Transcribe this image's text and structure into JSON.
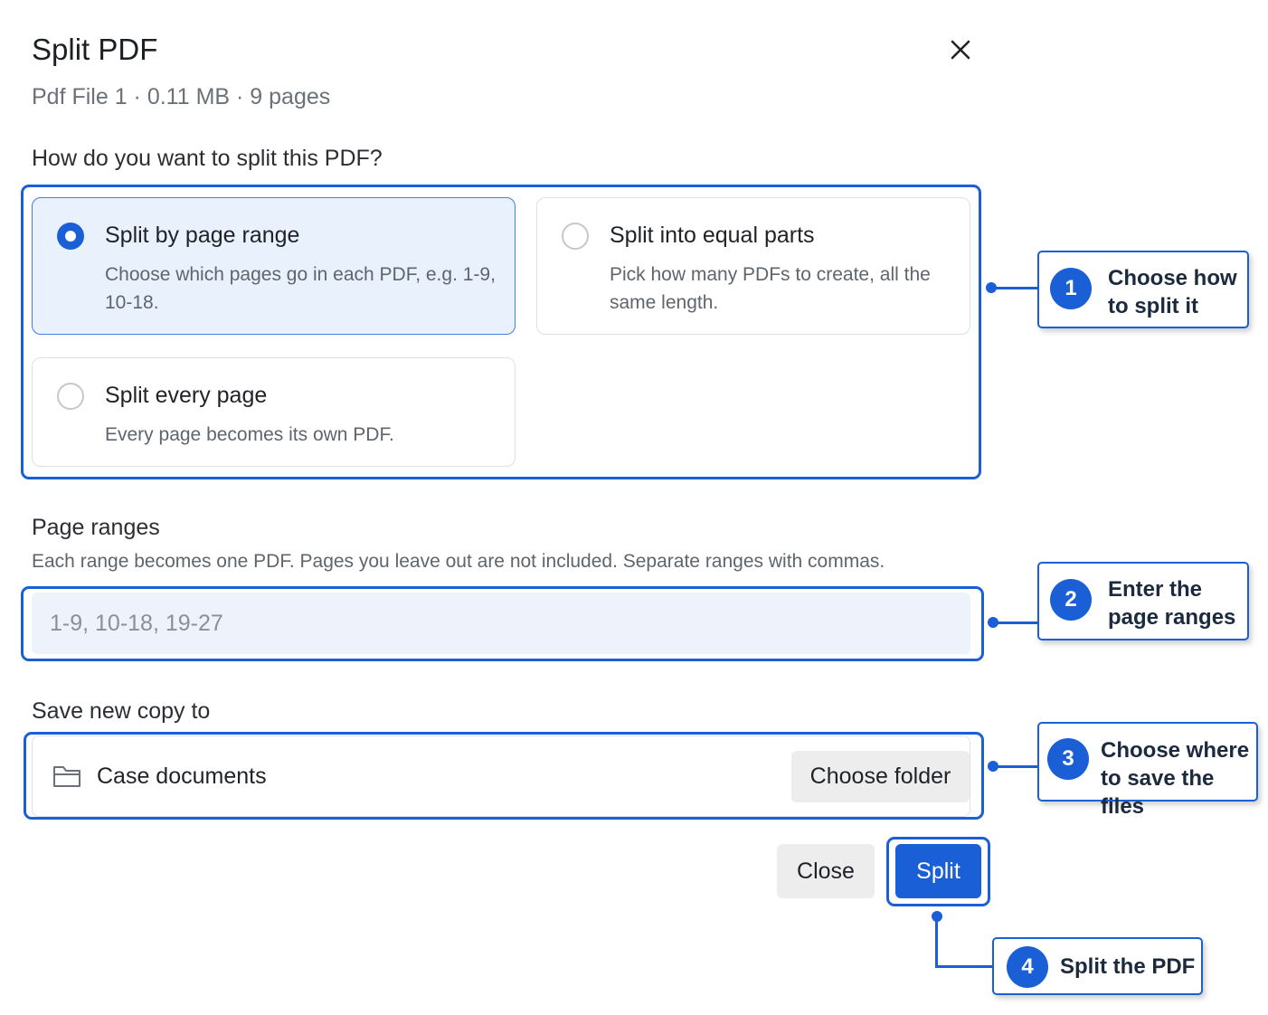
{
  "dialog": {
    "title": "Split PDF",
    "subtitle": "Pdf File 1 · 0.11 MB · 9 pages"
  },
  "split_mode": {
    "question": "How do you want to split this PDF?",
    "options": [
      {
        "title": "Split by page range",
        "description": "Choose which pages go in each PDF, e.g. 1-9, 10-18.",
        "selected": true
      },
      {
        "title": "Split into equal parts",
        "description": "Pick how many PDFs to create, all the same length.",
        "selected": false
      },
      {
        "title": "Split every page",
        "description": "Every page becomes its own PDF.",
        "selected": false
      }
    ]
  },
  "page_ranges": {
    "label": "Page ranges",
    "help": "Each range becomes one PDF. Pages you leave out are not included. Separate ranges with commas.",
    "value": "",
    "placeholder": "1-9, 10-18, 19-27"
  },
  "save_location": {
    "label": "Save new copy to",
    "folder_name": "Case documents",
    "choose_folder_label": "Choose folder"
  },
  "actions": {
    "close_label": "Close",
    "split_label": "Split"
  },
  "callouts": [
    {
      "number": "1",
      "text_line1": "Choose how",
      "text_line2": "to split it"
    },
    {
      "number": "2",
      "text_line1": "Enter the",
      "text_line2": "page ranges"
    },
    {
      "number": "3",
      "text_line1": "Choose where",
      "text_line2": "to save the files"
    },
    {
      "number": "4",
      "text_line1": "Split the PDF",
      "text_line2": ""
    }
  ],
  "colors": {
    "accent": "#1a5fd6",
    "selected_card_bg": "#e9f1fd",
    "input_bg": "#eef2fa",
    "secondary_button_bg": "#ededee"
  }
}
